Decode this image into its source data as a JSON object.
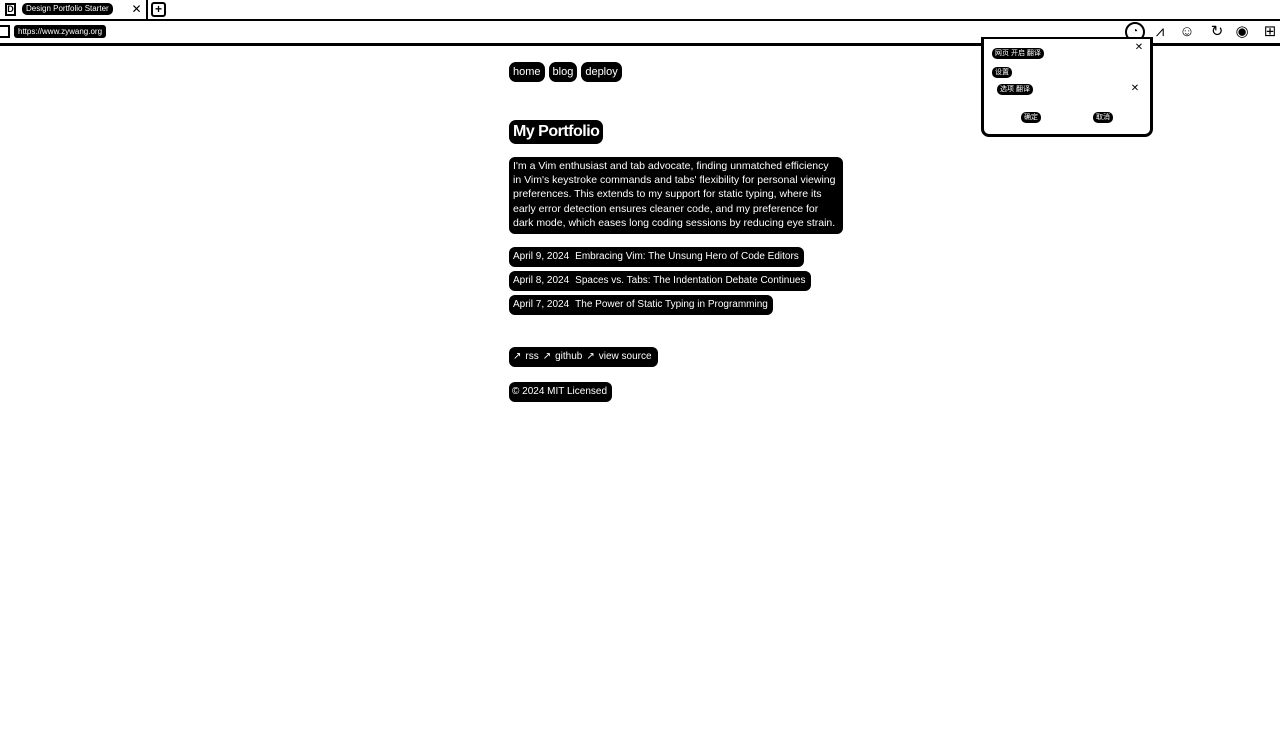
{
  "browser": {
    "tab_title": "Design Portfolio Starter",
    "tab_close": "✕",
    "new_tab": "+",
    "favicon": "D",
    "url": "https://www.zywang.org",
    "extensions": [
      "ext-puzzle-icon",
      "ext-ab-icon",
      "ext-robot-icon",
      "ext-refresh-icon",
      "ext-target-icon",
      "ext-grid-icon"
    ]
  },
  "popup": {
    "row1": "网页 开启 翻译",
    "row2": "设置",
    "row3": "选项 翻译",
    "btn_left": "确定",
    "btn_right": "取消",
    "close": "✕"
  },
  "nav": {
    "home": "home",
    "blog": "blog",
    "deploy": "deploy"
  },
  "page": {
    "title": "My Portfolio",
    "bio": "I'm a Vim enthusiast and tab advocate, finding unmatched efficiency in Vim's keystroke commands and tabs' flexibility for personal viewing preferences. This extends to my support for static typing, where its early error detection ensures cleaner code, and my preference for dark mode, which eases long coding sessions by reducing eye strain."
  },
  "posts": [
    {
      "date": "April 9, 2024",
      "title": "Embracing Vim: The Unsung Hero of Code Editors"
    },
    {
      "date": "April 8, 2024",
      "title": "Spaces vs. Tabs: The Indentation Debate Continues"
    },
    {
      "date": "April 7, 2024",
      "title": "The Power of Static Typing in Programming"
    }
  ],
  "footer": {
    "rss": "rss",
    "github": "github",
    "view_source": "view source",
    "arrow": "↗",
    "copyright": "© 2024 MIT Licensed"
  }
}
